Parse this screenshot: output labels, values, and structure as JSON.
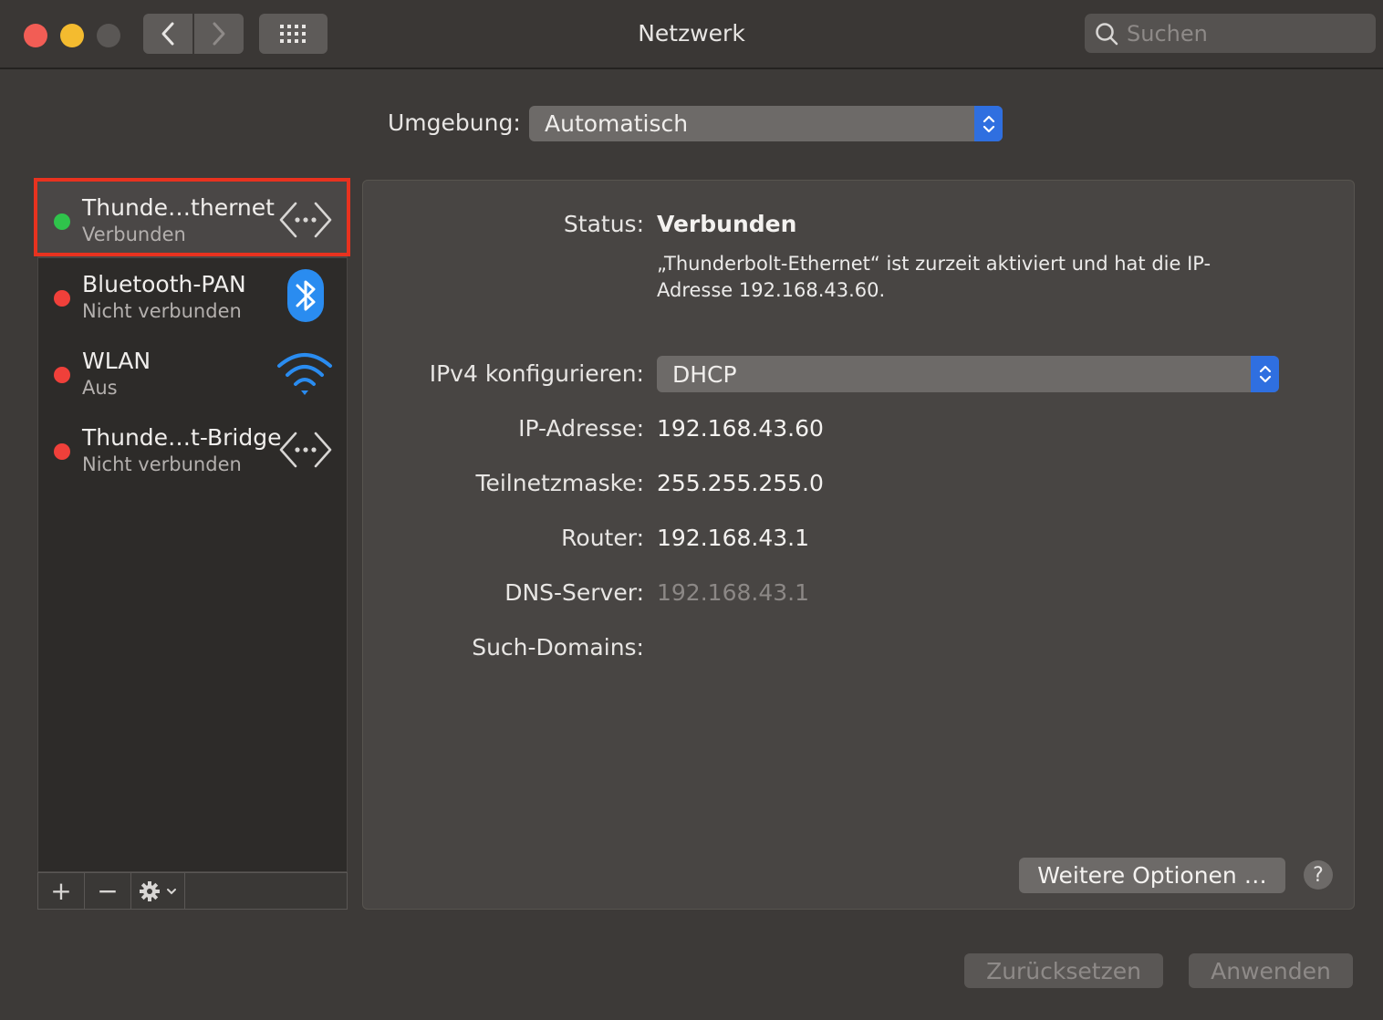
{
  "window": {
    "title": "Netzwerk"
  },
  "toolbar": {
    "search_placeholder": "Suchen"
  },
  "location": {
    "label": "Umgebung:",
    "value": "Automatisch"
  },
  "services": [
    {
      "name": "Thunde…thernet",
      "status": "Verbunden",
      "status_color": "#2fc34b",
      "icon": "ethernet-arrows-icon",
      "selected": true
    },
    {
      "name": "Bluetooth-PAN",
      "status": "Nicht verbunden",
      "status_color": "#f0403a",
      "icon": "bluetooth-icon",
      "selected": false
    },
    {
      "name": "WLAN",
      "status": "Aus",
      "status_color": "#f0403a",
      "icon": "wifi-icon",
      "selected": false
    },
    {
      "name": "Thunde…t-Bridge",
      "status": "Nicht verbunden",
      "status_color": "#f0403a",
      "icon": "ethernet-arrows-icon",
      "selected": false
    }
  ],
  "sidebar_tools": {
    "add": "+",
    "remove": "−"
  },
  "detail": {
    "status_label": "Status:",
    "status_value": "Verbunden",
    "status_description": "„Thunderbolt-Ethernet“ ist zurzeit aktiviert und hat die IP-Adresse 192.168.43.60.",
    "ipv4_label": "IPv4 konfigurieren:",
    "ipv4_value": "DHCP",
    "ip_label": "IP-Adresse:",
    "ip_value": "192.168.43.60",
    "subnet_label": "Teilnetzmaske:",
    "subnet_value": "255.255.255.0",
    "router_label": "Router:",
    "router_value": "192.168.43.1",
    "dns_label": "DNS-Server:",
    "dns_value": "192.168.43.1",
    "search_domains_label": "Such-Domains:",
    "more_options": "Weitere Optionen …",
    "help": "?"
  },
  "footer": {
    "reset": "Zurücksetzen",
    "apply": "Anwenden"
  }
}
